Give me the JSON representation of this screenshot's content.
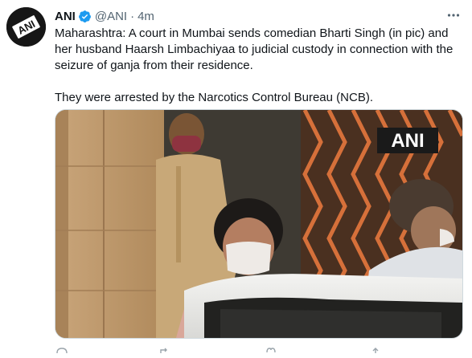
{
  "tweet": {
    "display_name": "ANI",
    "handle": "@ANI",
    "separator": "·",
    "time": "4m",
    "paragraphs": [
      "Maharashtra: A court in Mumbai sends comedian Bharti Singh (in pic) and her husband Haarsh Limbachiyaa to judicial custody in connection with the seizure of ganja from their residence.",
      "They were arrested by the Narcotics Control Bureau (NCB)."
    ],
    "media_watermark": "ANI",
    "avatar_logo": "ANI"
  },
  "icons": {
    "verified": "verified-badge-icon",
    "more": "more-options-icon",
    "reply": "reply-icon",
    "retweet": "retweet-icon",
    "like": "like-icon",
    "share": "share-icon"
  },
  "colors": {
    "text": "#0f1419",
    "secondary": "#536471",
    "verified": "#1d9bf0"
  }
}
